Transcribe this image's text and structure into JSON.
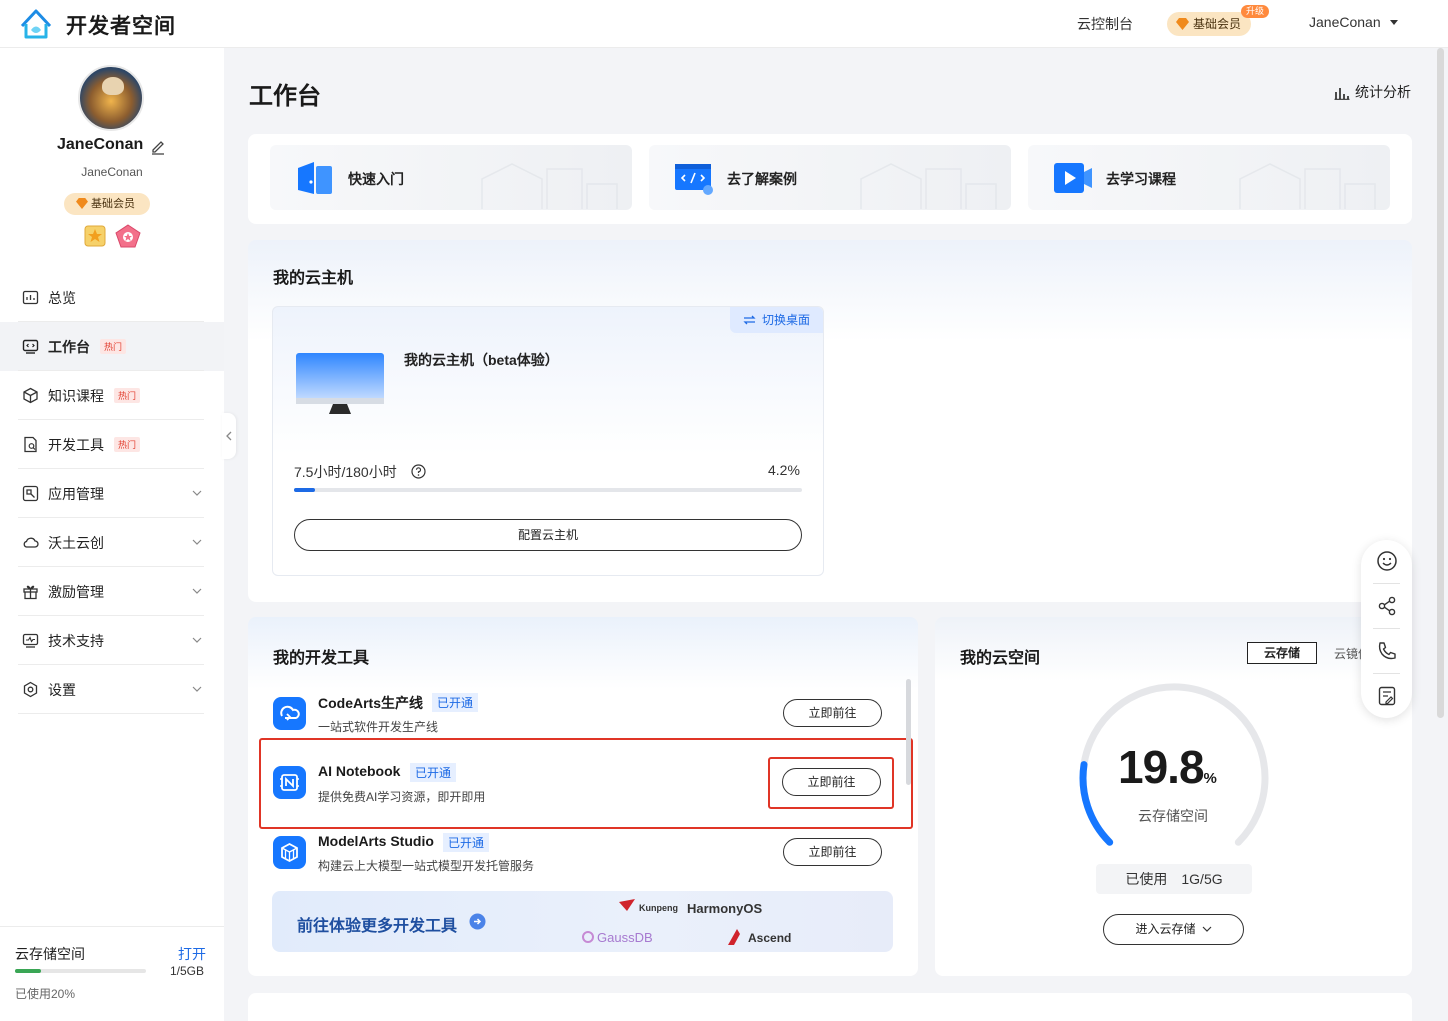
{
  "header": {
    "app_title": "开发者空间",
    "console_link": "云控制台",
    "member_badge": "基础会员",
    "upgrade_tag": "升级",
    "user_name": "JaneConan"
  },
  "sidebar": {
    "profile_name": "JaneConan",
    "profile_sub": "JaneConan",
    "member_badge": "基础会员",
    "nav": [
      {
        "label": "总览",
        "hot": ""
      },
      {
        "label": "工作台",
        "hot": "热门"
      },
      {
        "label": "知识课程",
        "hot": "热门"
      },
      {
        "label": "开发工具",
        "hot": "热门"
      },
      {
        "label": "应用管理"
      },
      {
        "label": "沃土云创"
      },
      {
        "label": "激励管理"
      },
      {
        "label": "技术支持"
      },
      {
        "label": "设置"
      }
    ],
    "storage": {
      "title": "云存储空间",
      "open_link": "打开",
      "size": "1/5GB",
      "used_text": "已使用20%",
      "used_fraction": 0.2
    }
  },
  "main": {
    "page_title": "工作台",
    "stats_link": "统计分析",
    "quick": [
      {
        "label": "快速入门"
      },
      {
        "label": "去了解案例"
      },
      {
        "label": "去学习课程"
      }
    ],
    "vm": {
      "section_title": "我的云主机",
      "switch_label": "切换桌面",
      "name": "我的云主机（beta体验）",
      "hours": "7.5小时/180小时",
      "percent": "4.2%",
      "usage_fraction": 0.042,
      "config_button": "配置云主机"
    },
    "tools": {
      "section_title": "我的开发工具",
      "items": [
        {
          "name": "CodeArts生产线",
          "tag": "已开通",
          "desc": "一站式软件开发生产线",
          "button": "立即前往"
        },
        {
          "name": "AI Notebook",
          "tag": "已开通",
          "desc": "提供免费AI学习资源，即开即用",
          "button": "立即前往"
        },
        {
          "name": "ModelArts Studio",
          "tag": "已开通",
          "desc": "构建云上大模型一站式模型开发托管服务",
          "button": "立即前往"
        }
      ],
      "more_banner": "前往体验更多开发工具",
      "brands": [
        "Kunpeng",
        "HarmonyOS",
        "GaussDB",
        "Ascend"
      ]
    },
    "cloud": {
      "section_title": "我的云空间",
      "tab_active": "云存储",
      "tab_other": "云镜像",
      "gauge_value": "19.8",
      "gauge_unit": "%",
      "gauge_fraction": 0.198,
      "gauge_label": "云存储空间",
      "used_label": "已使用",
      "used_value": "1G/5G",
      "enter_button": "进入云存储"
    }
  },
  "colors": {
    "accent": "#1d6ae5",
    "hot_text": "#e23d2e",
    "member_bg": "#fbe5c2",
    "highlight_box": "#e03526"
  }
}
